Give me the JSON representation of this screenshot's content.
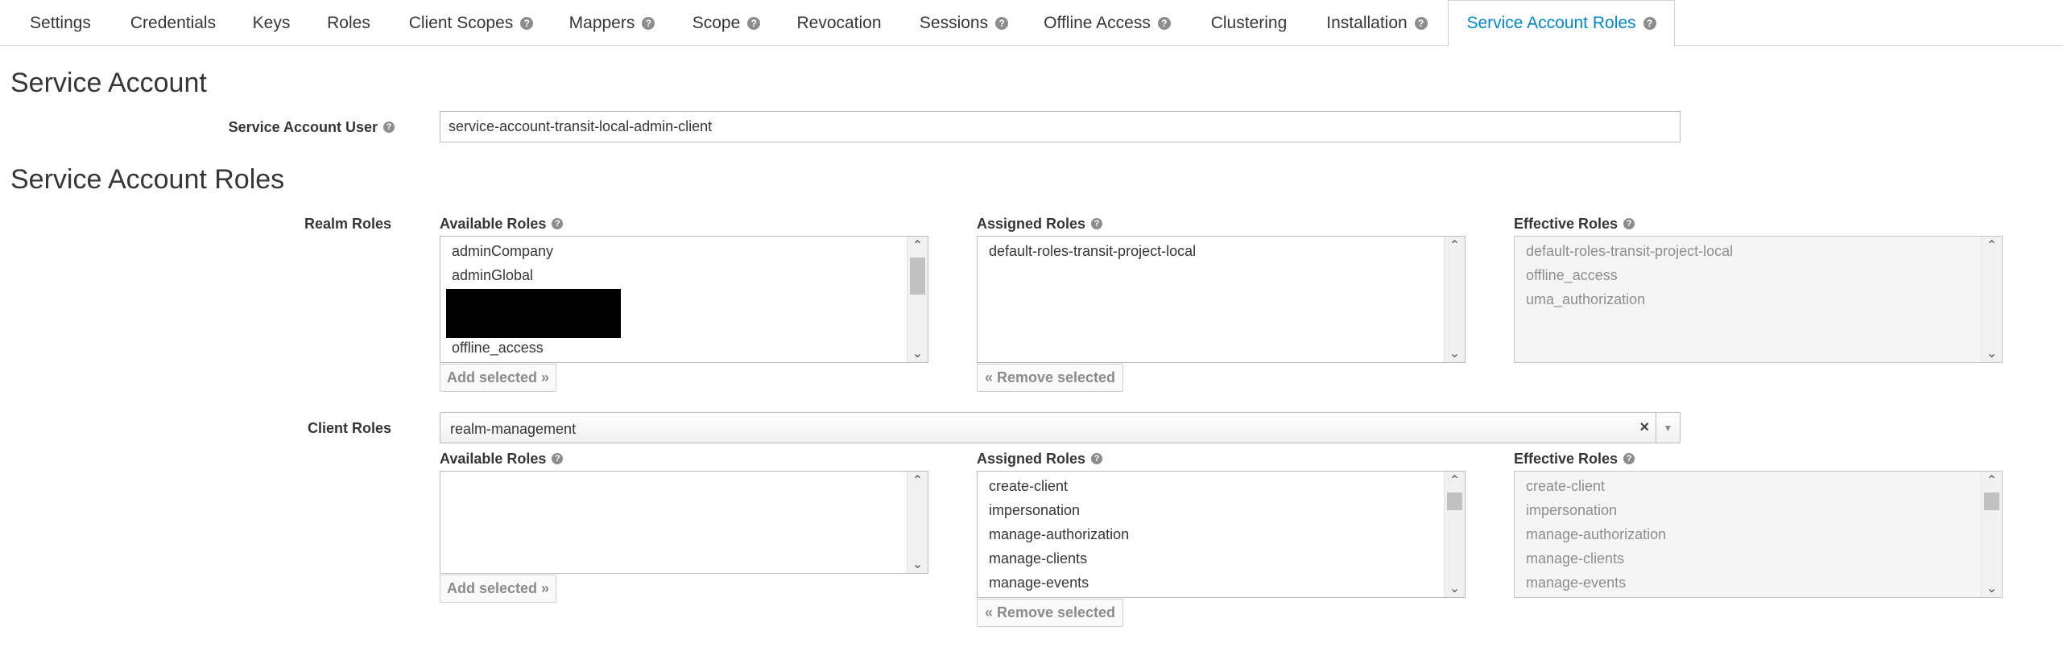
{
  "tabs": [
    {
      "label": "Settings",
      "help": false,
      "active": false
    },
    {
      "label": "Credentials",
      "help": false,
      "active": false
    },
    {
      "label": "Keys",
      "help": false,
      "active": false
    },
    {
      "label": "Roles",
      "help": false,
      "active": false
    },
    {
      "label": "Client Scopes",
      "help": true,
      "active": false
    },
    {
      "label": "Mappers",
      "help": true,
      "active": false
    },
    {
      "label": "Scope",
      "help": true,
      "active": false
    },
    {
      "label": "Revocation",
      "help": false,
      "active": false
    },
    {
      "label": "Sessions",
      "help": true,
      "active": false
    },
    {
      "label": "Offline Access",
      "help": true,
      "active": false
    },
    {
      "label": "Clustering",
      "help": false,
      "active": false
    },
    {
      "label": "Installation",
      "help": true,
      "active": false
    },
    {
      "label": "Service Account Roles",
      "help": true,
      "active": true
    }
  ],
  "service_account": {
    "title": "Service Account",
    "user_label": "Service Account User",
    "user_value": "service-account-transit-local-admin-client"
  },
  "roles": {
    "title": "Service Account Roles",
    "available_label": "Available Roles",
    "assigned_label": "Assigned Roles",
    "effective_label": "Effective Roles",
    "add_button": "Add selected",
    "remove_button": "Remove selected",
    "realm": {
      "label": "Realm Roles",
      "available": [
        "adminCompany",
        "adminGlobal",
        "",
        "offline_access"
      ],
      "assigned": [
        "default-roles-transit-project-local"
      ],
      "effective": [
        "default-roles-transit-project-local",
        "offline_access",
        "uma_authorization"
      ]
    },
    "client": {
      "label": "Client Roles",
      "selected_client": "realm-management",
      "available": [],
      "assigned": [
        "create-client",
        "impersonation",
        "manage-authorization",
        "manage-clients",
        "manage-events"
      ],
      "effective": [
        "create-client",
        "impersonation",
        "manage-authorization",
        "manage-clients",
        "manage-events"
      ]
    }
  },
  "icons": {
    "help": "question-circle-icon",
    "clear": "times-icon",
    "dropdown": "caret-down-icon",
    "scroll_up": "chevron-up-icon",
    "scroll_down": "chevron-down-icon",
    "double_left": "angle-double-left-icon",
    "double_right": "angle-double-right-icon"
  },
  "colors": {
    "active_tab": "#0088ce",
    "text": "#363636",
    "disabled_text": "#8e8e8e",
    "help_icon": "#8b8d8f"
  }
}
